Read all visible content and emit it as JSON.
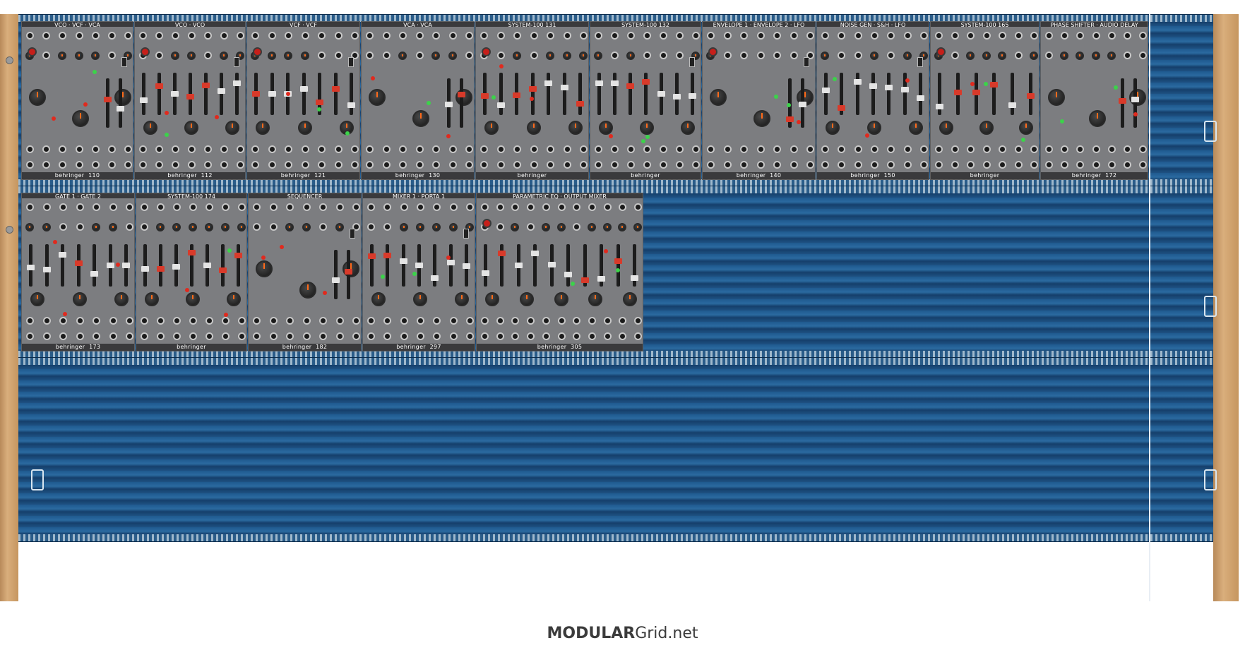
{
  "rack": {
    "rows": [
      {
        "id": "row-1",
        "modules": [
          {
            "name": "110",
            "brand": "behringer"
          },
          {
            "name": "112",
            "brand": "behringer"
          },
          {
            "name": "121",
            "brand": "behringer"
          },
          {
            "name": "130",
            "brand": "behringer"
          },
          {
            "name": "131",
            "brand": "behringer"
          },
          {
            "name": "132",
            "brand": "behringer"
          },
          {
            "name": "140",
            "brand": "behringer"
          },
          {
            "name": "150",
            "brand": "behringer"
          },
          {
            "name": "165",
            "brand": "behringer"
          },
          {
            "name": "172",
            "brand": "behringer"
          }
        ]
      },
      {
        "id": "row-2",
        "modules": [
          {
            "name": "173",
            "brand": "behringer"
          },
          {
            "name": "174",
            "brand": "behringer"
          },
          {
            "name": "182",
            "brand": "behringer"
          },
          {
            "name": "297",
            "brand": "behringer"
          },
          {
            "name": "305",
            "brand": "behringer"
          }
        ]
      },
      {
        "id": "row-3",
        "modules": []
      }
    ],
    "colors": {
      "rack_blue": "#1f5a8f",
      "panel_grey": "#7c7d80",
      "wood": "#d0a06c",
      "led_red": "#e02a1e",
      "led_green": "#3cd24a",
      "knob_accent": "#ff6a1a"
    }
  },
  "footer": {
    "brand_bold": "MODULAR",
    "brand_rest": "Grid.net"
  }
}
